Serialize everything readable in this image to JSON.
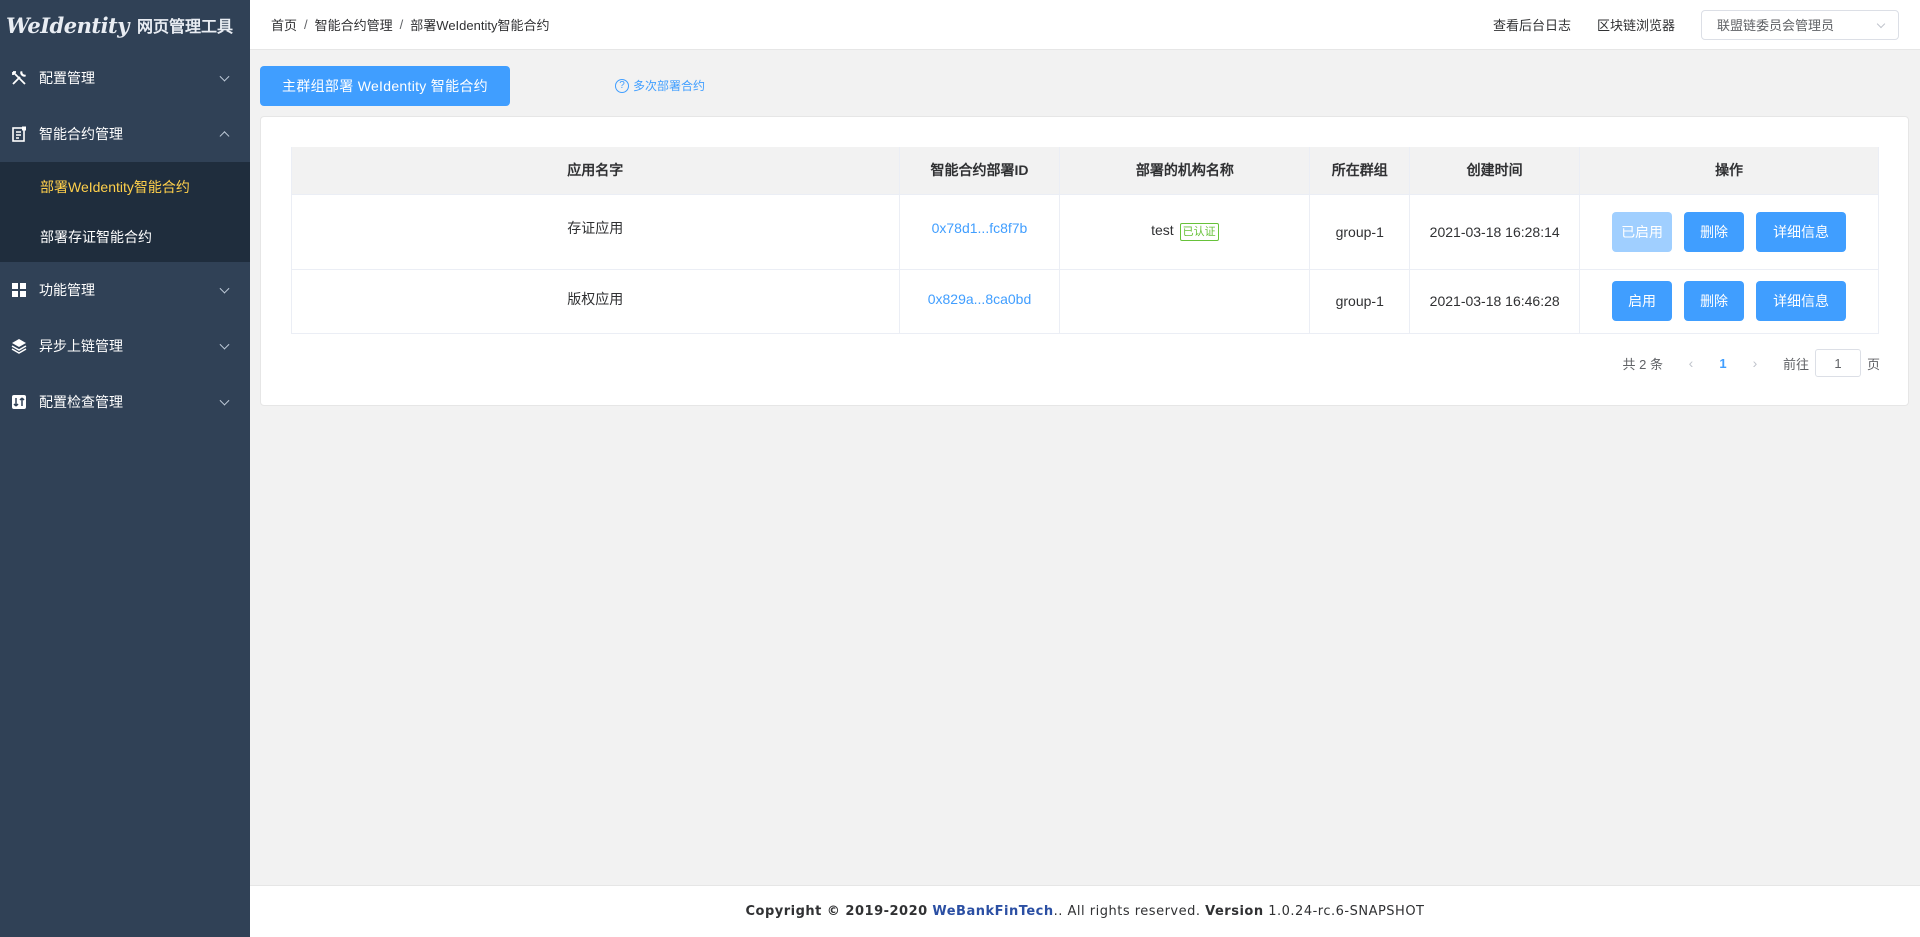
{
  "logo": {
    "brand": "WeIdentity",
    "text": "网页管理工具"
  },
  "sidebar": {
    "items": [
      {
        "label": "配置管理",
        "icon": "tools-icon"
      },
      {
        "label": "智能合约管理",
        "icon": "contract-icon",
        "expanded": true,
        "children": [
          {
            "label": "部署WeIdentity智能合约",
            "active": true
          },
          {
            "label": "部署存证智能合约"
          }
        ]
      },
      {
        "label": "功能管理",
        "icon": "grid-icon"
      },
      {
        "label": "异步上链管理",
        "icon": "layers-icon"
      },
      {
        "label": "配置检查管理",
        "icon": "check-icon"
      }
    ]
  },
  "breadcrumb": {
    "home": "首页",
    "section": "智能合约管理",
    "page": "部署WeIdentity智能合约"
  },
  "topbar": {
    "log_link": "查看后台日志",
    "explorer_link": "区块链浏览器",
    "role": "联盟链委员会管理员"
  },
  "main": {
    "deploy_button": "主群组部署 WeIdentity 智能合约",
    "multi_deploy_link": "多次部署合约"
  },
  "table": {
    "headers": [
      "应用名字",
      "智能合约部署ID",
      "部署的机构名称",
      "所在群组",
      "创建时间",
      "操作"
    ],
    "rows": [
      {
        "app_name": "存证应用",
        "contract_id": "0x78d1...fc8f7b",
        "org": "test",
        "org_badge": "已认证",
        "group": "group-1",
        "created": "2021-03-18 16:28:14",
        "enable_label": "已启用",
        "delete_label": "删除",
        "detail_label": "详细信息"
      },
      {
        "app_name": "版权应用",
        "contract_id": "0x829a...8ca0bd",
        "org": "",
        "org_badge": "",
        "group": "group-1",
        "created": "2021-03-18 16:46:28",
        "enable_label": "启用",
        "delete_label": "删除",
        "detail_label": "详细信息"
      }
    ]
  },
  "pagination": {
    "total_text": "共 2 条",
    "current_page": "1",
    "goto_label": "前往",
    "page_input": "1",
    "page_suffix": "页"
  },
  "footer": {
    "copyright": "Copyright © 2019-2020",
    "brand": "WeBankFinTech",
    "rights": ".. All rights reserved.",
    "version_label": "Version",
    "version": "1.0.24-rc.6-SNAPSHOT"
  },
  "colors": {
    "sidebar_bg": "#304156",
    "submenu_bg": "#1f2d3d",
    "active_menu": "#ffd04b",
    "primary": "#409eff",
    "success": "#67c23a"
  }
}
